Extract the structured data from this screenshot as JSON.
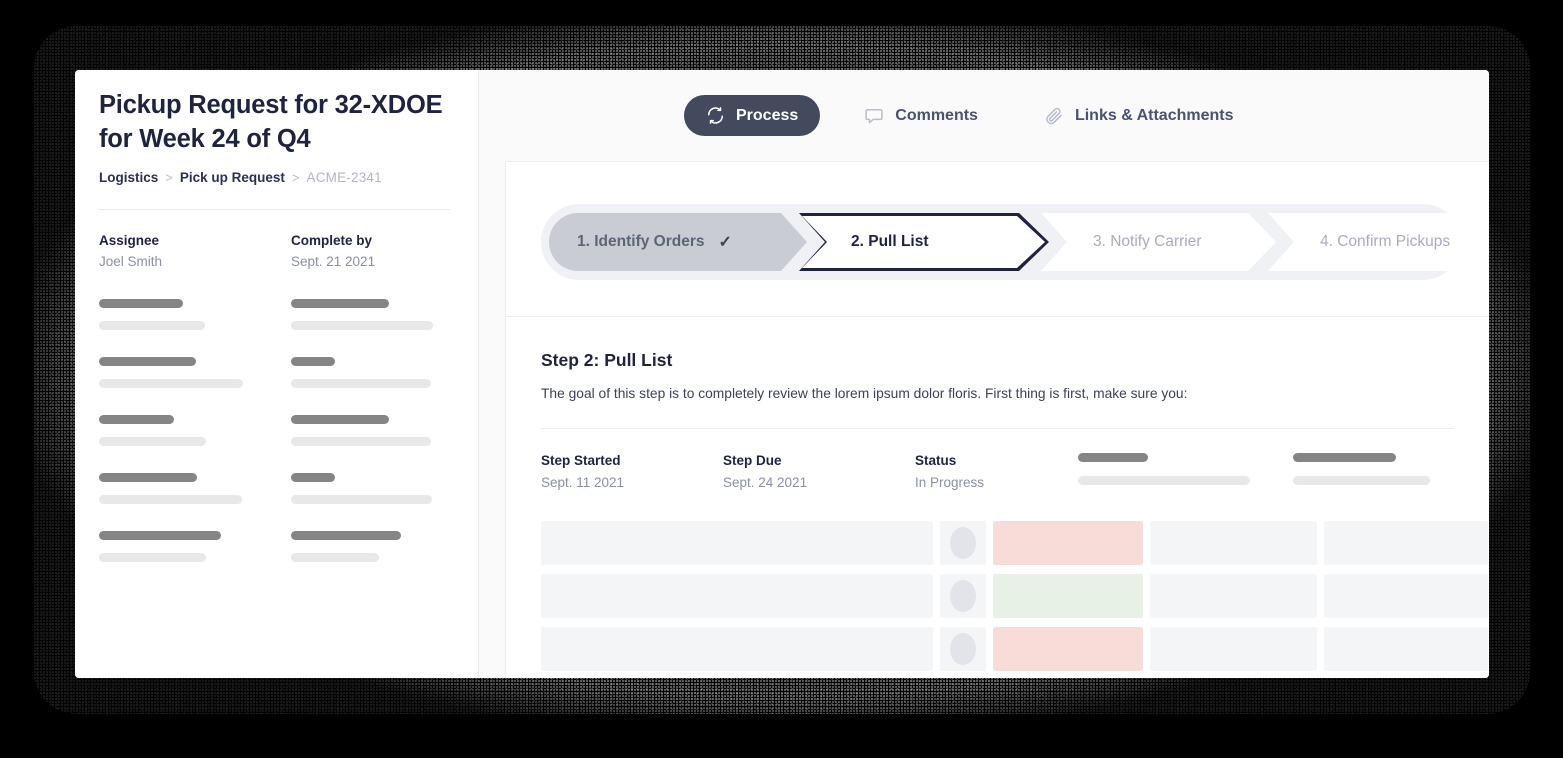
{
  "sidebar": {
    "doc_title": "Pickup Request for 32-XDOE for Week 24 of Q4",
    "breadcrumb": {
      "items": [
        "Logistics",
        "Pick up Request",
        "ACME-2341"
      ],
      "separator": ">"
    },
    "meta": [
      {
        "label": "Assignee",
        "value": "Joel Smith"
      },
      {
        "label": "Complete by",
        "value": "Sept. 21 2021"
      }
    ],
    "skeleton_rows": [
      {
        "left_label_w": 84,
        "left_value_w": 106,
        "right_label_w": 98,
        "right_value_w": 142
      },
      {
        "left_label_w": 97,
        "left_value_w": 144,
        "right_label_w": 44,
        "right_value_w": 140
      },
      {
        "left_label_w": 75,
        "left_value_w": 107,
        "right_label_w": 98,
        "right_value_w": 140
      },
      {
        "left_label_w": 98,
        "left_value_w": 143,
        "right_label_w": 44,
        "right_value_w": 141
      },
      {
        "left_label_w": 122,
        "left_value_w": 107,
        "right_label_w": 110,
        "right_value_w": 88
      }
    ]
  },
  "tabs": [
    {
      "label": "Process",
      "icon": "refresh-icon",
      "active": true
    },
    {
      "label": "Comments",
      "icon": "comment-icon",
      "active": false
    },
    {
      "label": "Links & Attachments",
      "icon": "paperclip-icon",
      "active": false
    }
  ],
  "stepper": {
    "steps": [
      {
        "label": "1. Identify Orders",
        "state": "completed",
        "check": "✓"
      },
      {
        "label": "2. Pull List",
        "state": "active"
      },
      {
        "label": "3. Notify Carrier",
        "state": "upcoming"
      },
      {
        "label": "4. Confirm Pickups",
        "state": "upcoming"
      }
    ]
  },
  "step_detail": {
    "title": "Step 2: Pull List",
    "description": "The goal of this step is to completely review the lorem ipsum dolor floris. First thing is first, make sure you:",
    "fields": [
      {
        "label": "Step Started",
        "value": "Sept. 11 2021"
      },
      {
        "label": "Step Due",
        "value": "Sept. 24 2021"
      },
      {
        "label": "Status",
        "value": "In Progress"
      }
    ],
    "skeleton_fields": [
      {
        "label_w": 70,
        "value_w": 172
      },
      {
        "label_w": 103,
        "value_w": 137
      }
    ]
  },
  "table": {
    "rows": [
      {
        "status_color": "#f8dcd8"
      },
      {
        "status_color": "#e7f1e5"
      },
      {
        "status_color": "#f8dcd8"
      }
    ]
  },
  "colors": {
    "accent_dark": "#434a5e",
    "navy": "#1f2340",
    "muted": "#8b90a0",
    "skeleton_dark": "#858585",
    "skeleton_light": "#e8e8e9",
    "cell_bg": "#f4f5f7",
    "status_pink": "#f8dcd8",
    "status_green": "#e7f1e5",
    "page_bg": "#000000"
  }
}
